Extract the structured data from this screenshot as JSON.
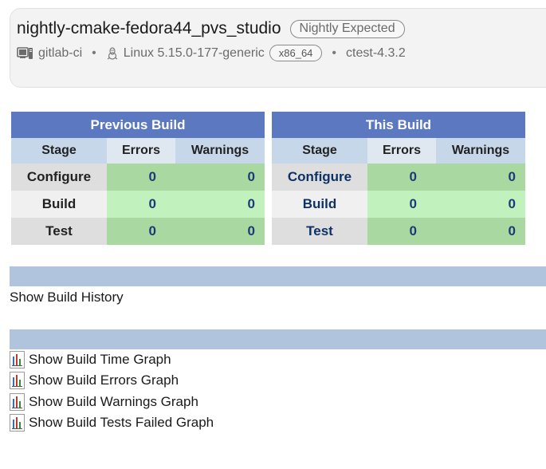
{
  "header": {
    "build_name": "nightly-cmake-fedora44_pvs_studio",
    "group_badge": "Nightly Expected",
    "site": "gitlab-ci",
    "os": "Linux 5.15.0-177-generic",
    "arch": "x86_64",
    "ctest_version": "ctest-4.3.2",
    "separator": "•"
  },
  "previous_build": {
    "title": "Previous Build",
    "columns": [
      "Stage",
      "Errors",
      "Warnings"
    ],
    "rows": [
      {
        "stage": "Configure",
        "errors": "0",
        "warnings": "0"
      },
      {
        "stage": "Build",
        "errors": "0",
        "warnings": "0"
      },
      {
        "stage": "Test",
        "errors": "0",
        "warnings": "0"
      }
    ]
  },
  "this_build": {
    "title": "This Build",
    "columns": [
      "Stage",
      "Errors",
      "Warnings"
    ],
    "rows": [
      {
        "stage": "Configure",
        "errors": "0",
        "warnings": "0"
      },
      {
        "stage": "Build",
        "errors": "0",
        "warnings": "0"
      },
      {
        "stage": "Test",
        "errors": "0",
        "warnings": "0"
      }
    ]
  },
  "history": {
    "label": "Show Build History"
  },
  "graphs": {
    "links": [
      "Show Build Time Graph",
      "Show Build Errors Graph",
      "Show Build Warnings Graph",
      "Show Build Tests Failed Graph"
    ]
  },
  "colors": {
    "table_title_bg": "#5b78c0",
    "column_header_bg": "#c7d7ea",
    "pass_dark": "#a9d9a0",
    "pass_light": "#c1f1bc",
    "section_bar": "#b0c4de"
  },
  "icons": {
    "site": "server-icon",
    "os": "linux-penguin-icon",
    "graph": "bar-chart-icon"
  }
}
